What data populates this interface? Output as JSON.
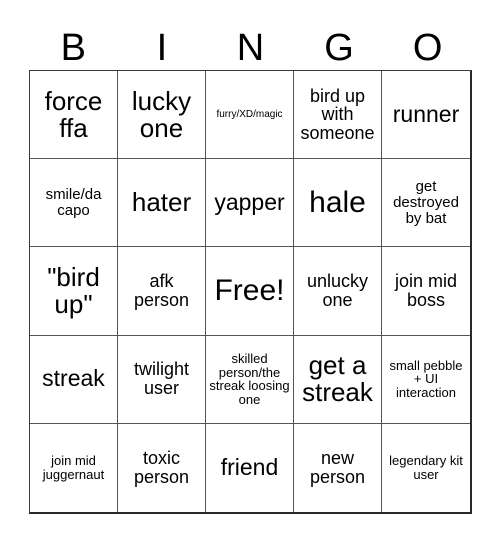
{
  "card": {
    "title": "BINGO",
    "header_letters": [
      "B",
      "I",
      "N",
      "G",
      "O"
    ],
    "free_space_label": "Free!",
    "colors": {
      "background": "#ffffff",
      "text": "#000000",
      "gridline": "#555555",
      "border": "#2a2a2a"
    },
    "rows": [
      [
        {
          "text": "force ffa",
          "size": "sz-xl"
        },
        {
          "text": "lucky one",
          "size": "sz-xl"
        },
        {
          "text": "furry/XD/magic",
          "size": "sz-xxs"
        },
        {
          "text": "bird up with someone",
          "size": "sz-md"
        },
        {
          "text": "runner",
          "size": "sz-lg"
        }
      ],
      [
        {
          "text": "smile/da capo",
          "size": "sz-sm"
        },
        {
          "text": "hater",
          "size": "sz-xl"
        },
        {
          "text": "yapper",
          "size": "sz-lg"
        },
        {
          "text": "hale",
          "size": "sz-xxl"
        },
        {
          "text": "get destroyed by bat",
          "size": "sz-sm"
        }
      ],
      [
        {
          "text": "\"bird up\"",
          "size": "sz-xl"
        },
        {
          "text": "afk person",
          "size": "sz-md"
        },
        {
          "text": "Free!",
          "size": "sz-xxl"
        },
        {
          "text": "unlucky one",
          "size": "sz-md"
        },
        {
          "text": "join mid boss",
          "size": "sz-md"
        }
      ],
      [
        {
          "text": "streak",
          "size": "sz-lg"
        },
        {
          "text": "twilight user",
          "size": "sz-md"
        },
        {
          "text": "skilled person/the streak loosing one",
          "size": "sz-xs"
        },
        {
          "text": "get a streak",
          "size": "sz-xl"
        },
        {
          "text": "small pebble + UI interaction",
          "size": "sz-xs"
        }
      ],
      [
        {
          "text": "join mid juggernaut",
          "size": "sz-xs"
        },
        {
          "text": "toxic person",
          "size": "sz-md"
        },
        {
          "text": "friend",
          "size": "sz-lg"
        },
        {
          "text": "new person",
          "size": "sz-md"
        },
        {
          "text": "legendary kit user",
          "size": "sz-xs"
        }
      ]
    ]
  }
}
